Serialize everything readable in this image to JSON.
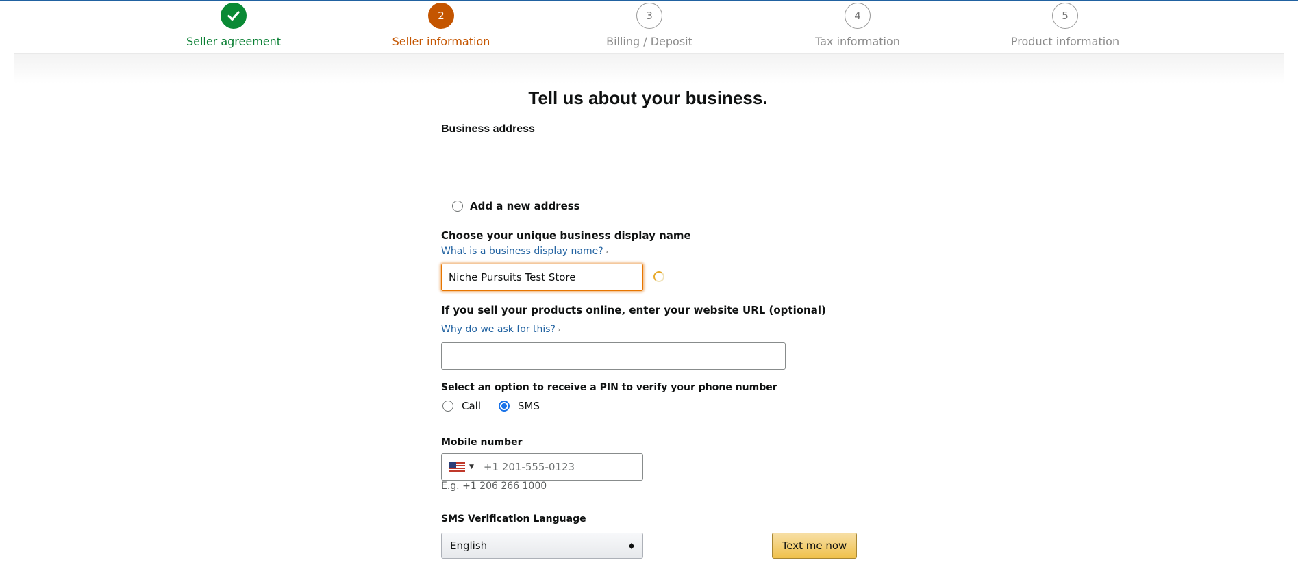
{
  "stepper": {
    "steps": [
      {
        "number": "",
        "label": "Seller agreement",
        "state": "done"
      },
      {
        "number": "2",
        "label": "Seller information",
        "state": "current"
      },
      {
        "number": "3",
        "label": "Billing / Deposit",
        "state": "upcoming"
      },
      {
        "number": "4",
        "label": "Tax information",
        "state": "upcoming"
      },
      {
        "number": "5",
        "label": "Product information",
        "state": "upcoming"
      }
    ]
  },
  "form": {
    "title": "Tell us about your business.",
    "business_address_label": "Business address",
    "add_address_label": "Add a new address",
    "display_name": {
      "label": "Choose your unique business display name",
      "help_link": "What is a business display name?",
      "value": "Niche Pursuits Test Store"
    },
    "website": {
      "label": "If you sell your products online, enter your website URL (optional)",
      "help_link": "Why do we ask for this?",
      "value": ""
    },
    "pin": {
      "label": "Select an option to receive a PIN to verify your phone number",
      "options": [
        {
          "label": "Call",
          "selected": false
        },
        {
          "label": "SMS",
          "selected": true
        }
      ]
    },
    "mobile": {
      "label": "Mobile number",
      "country_icon": "us-flag-icon",
      "placeholder": "+1 201-555-0123",
      "example": "E.g. +1 206 266 1000"
    },
    "sms_language": {
      "label": "SMS Verification Language",
      "selected": "English"
    },
    "text_me_button": "Text me now"
  },
  "colors": {
    "done": "#0a8a35",
    "current": "#c45500",
    "link": "#2162a1",
    "button": "#f0c14b"
  }
}
